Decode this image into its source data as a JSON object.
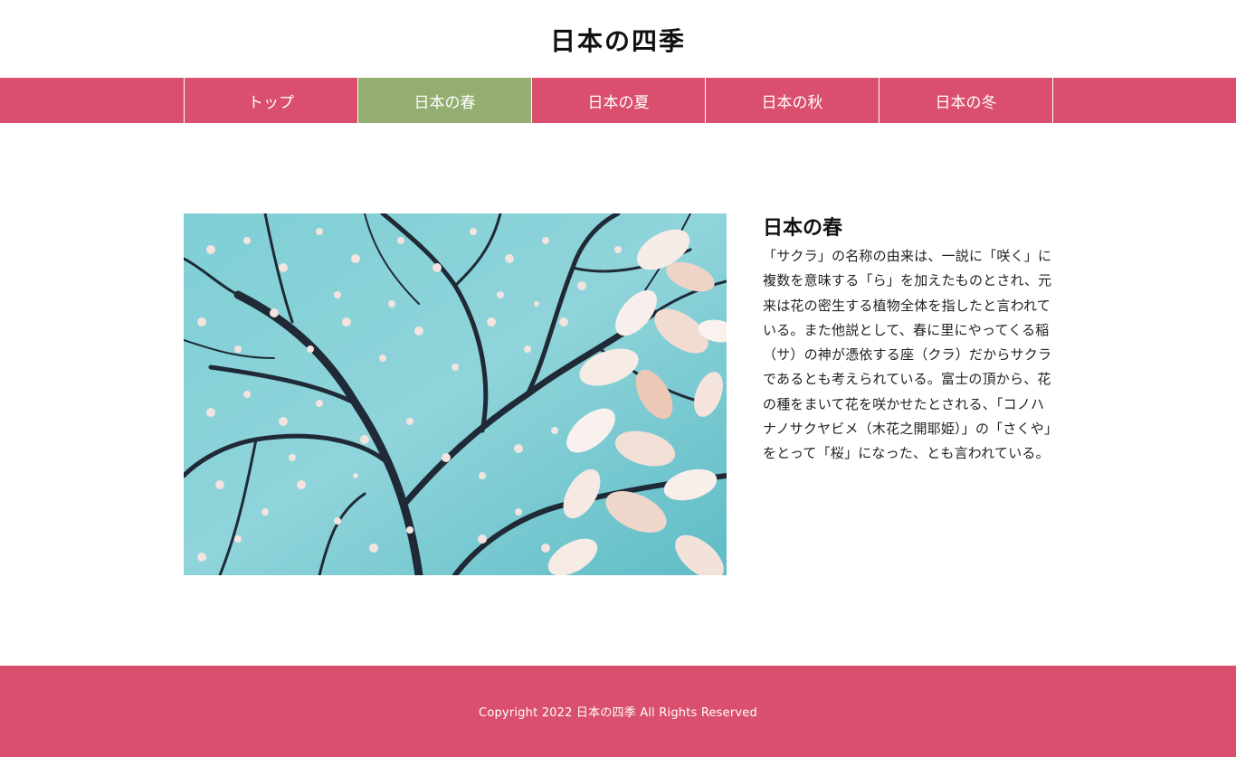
{
  "colors": {
    "accent": "#d94f6d",
    "active": "#93ae70"
  },
  "header": {
    "title": "日本の四季"
  },
  "nav": {
    "items": [
      {
        "label": "トップ",
        "active": false
      },
      {
        "label": "日本の春",
        "active": true
      },
      {
        "label": "日本の夏",
        "active": false
      },
      {
        "label": "日本の秋",
        "active": false
      },
      {
        "label": "日本の冬",
        "active": false
      }
    ]
  },
  "main": {
    "image_icon": "cherry-blossom-photo",
    "article": {
      "title": "日本の春",
      "body": "「サクラ」の名称の由来は、一説に「咲く」に複数を意味する「ら」を加えたものとされ、元来は花の密生する植物全体を指したと言われている。また他説として、春に里にやってくる稲（サ）の神が憑依する座（クラ）だからサクラであるとも考えられている。富士の頂から、花の種をまいて花を咲かせたとされる、「コノハナノサクヤビメ（木花之開耶姫）」の「さくや」をとって「桜」になった、とも言われている。"
    }
  },
  "footer": {
    "copyright": "Copyright 2022 日本の四季 All Rights Reserved"
  }
}
